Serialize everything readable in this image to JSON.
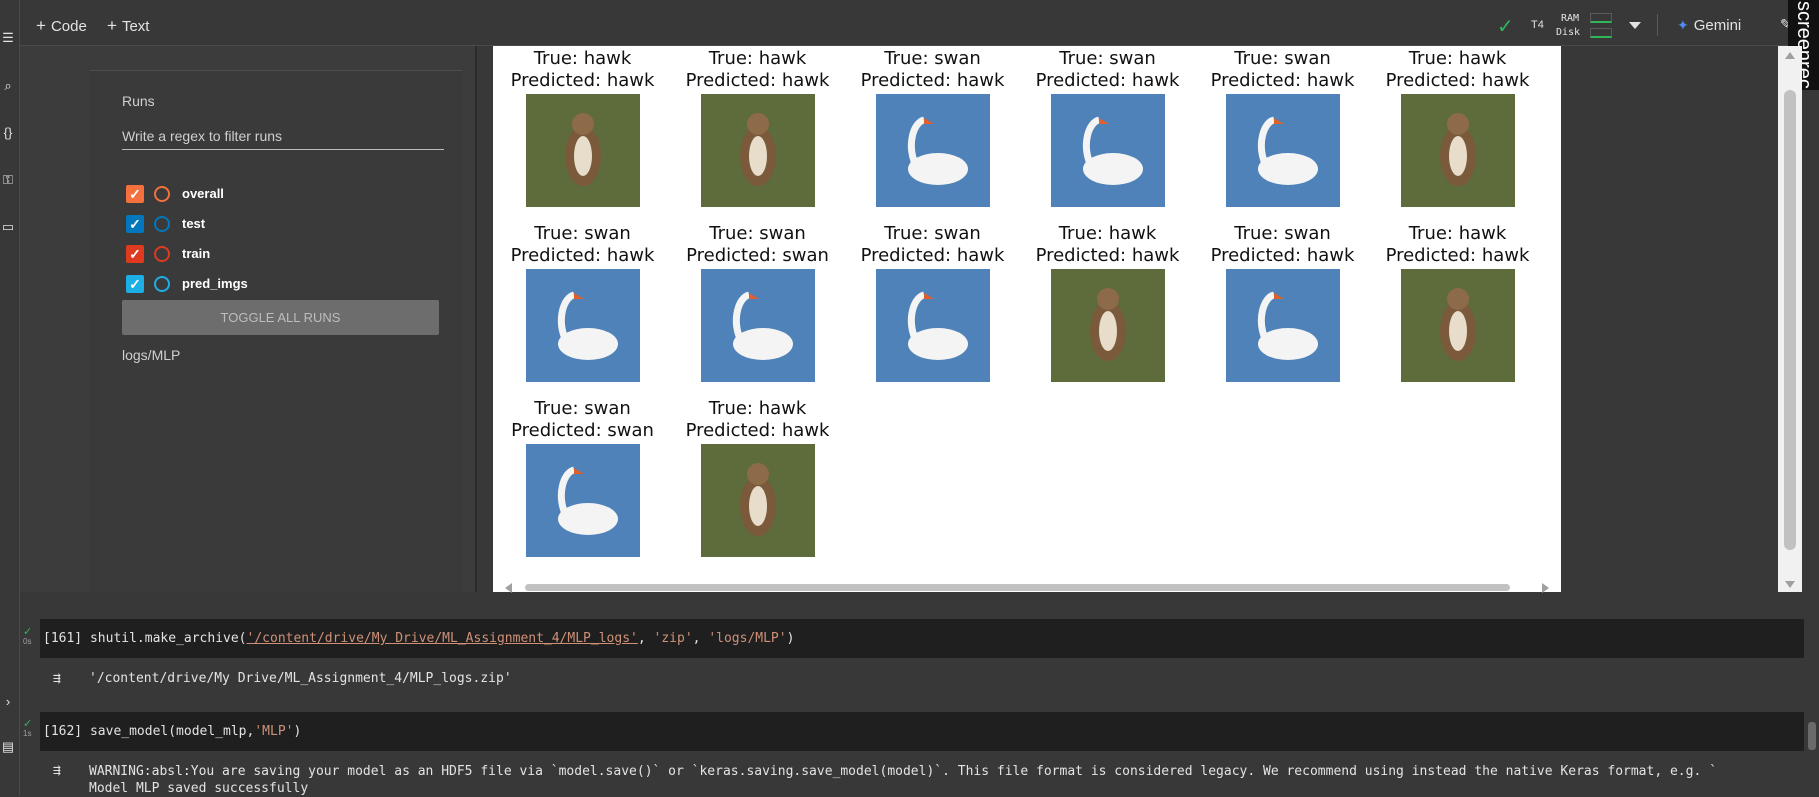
{
  "toolbar": {
    "add_code_label": "Code",
    "add_text_label": "Text",
    "runtime_type": "T4",
    "ram_label": "RAM",
    "disk_label": "Disk",
    "gemini_label": "Gemini"
  },
  "overlay": {
    "screenrec_label": "screenrec"
  },
  "tensorboard": {
    "runs_title": "Runs",
    "filter_placeholder": "Write a regex to filter runs",
    "runs": [
      {
        "name": "overall",
        "checked": true,
        "color": "#f4703c"
      },
      {
        "name": "test",
        "checked": true,
        "color": "#0277bd"
      },
      {
        "name": "train",
        "checked": true,
        "color": "#dd3a20"
      },
      {
        "name": "pred_imgs",
        "checked": true,
        "color": "#1eaee6"
      }
    ],
    "toggle_all_label": "TOGGLE ALL RUNS",
    "logdir": "logs/MLP"
  },
  "predictions": [
    {
      "true_label": "True: hawk",
      "pred_label": "Predicted: hawk",
      "subject": "hawk"
    },
    {
      "true_label": "True: hawk",
      "pred_label": "Predicted: hawk",
      "subject": "hawk"
    },
    {
      "true_label": "True: swan",
      "pred_label": "Predicted: hawk",
      "subject": "swan"
    },
    {
      "true_label": "True: swan",
      "pred_label": "Predicted: hawk",
      "subject": "swan"
    },
    {
      "true_label": "True: swan",
      "pred_label": "Predicted: hawk",
      "subject": "swan"
    },
    {
      "true_label": "True: hawk",
      "pred_label": "Predicted: hawk",
      "subject": "hawk"
    },
    {
      "true_label": "True: swan",
      "pred_label": "Predicted: hawk",
      "subject": "swan"
    },
    {
      "true_label": "True: swan",
      "pred_label": "Predicted: swan",
      "subject": "swan"
    },
    {
      "true_label": "True: swan",
      "pred_label": "Predicted: hawk",
      "subject": "swan"
    },
    {
      "true_label": "True: hawk",
      "pred_label": "Predicted: hawk",
      "subject": "hawk"
    },
    {
      "true_label": "True: swan",
      "pred_label": "Predicted: hawk",
      "subject": "swan"
    },
    {
      "true_label": "True: hawk",
      "pred_label": "Predicted: hawk",
      "subject": "hawk"
    },
    {
      "true_label": "True: swan",
      "pred_label": "Predicted: swan",
      "subject": "swan"
    },
    {
      "true_label": "True: hawk",
      "pred_label": "Predicted: hawk",
      "subject": "hawk"
    }
  ],
  "cells": [
    {
      "exec_count": "[161]",
      "duration": "0s",
      "code_prefix": "shutil.make_archive(",
      "code_arg1": "'/content/drive/My Drive/ML_Assignment_4/MLP_logs'",
      "code_sep1": ", ",
      "code_arg2": "'zip'",
      "code_sep2": ", ",
      "code_arg3": "'logs/MLP'",
      "code_suffix": ")",
      "output": "'/content/drive/My Drive/ML_Assignment_4/MLP_logs.zip'"
    },
    {
      "exec_count": "[162]",
      "duration": "1s",
      "code_prefix": "save_model(model_mlp,",
      "code_arg1": "'MLP'",
      "code_suffix": ")",
      "output_line1": "WARNING:absl:You are saving your model as an HDF5 file via `model.save()` or `keras.saving.save_model(model)`. This file format is considered legacy. We recommend using instead the native Keras format, e.g. `",
      "output_line2": "Model MLP saved successfully"
    }
  ],
  "colors": {
    "accent_green": "#2fb55a",
    "gemini_blue": "#4d8df5",
    "string_literal": "#ce9178",
    "hawk_bg": "#5e6b3a",
    "swan_bg": "#4f82b9"
  }
}
